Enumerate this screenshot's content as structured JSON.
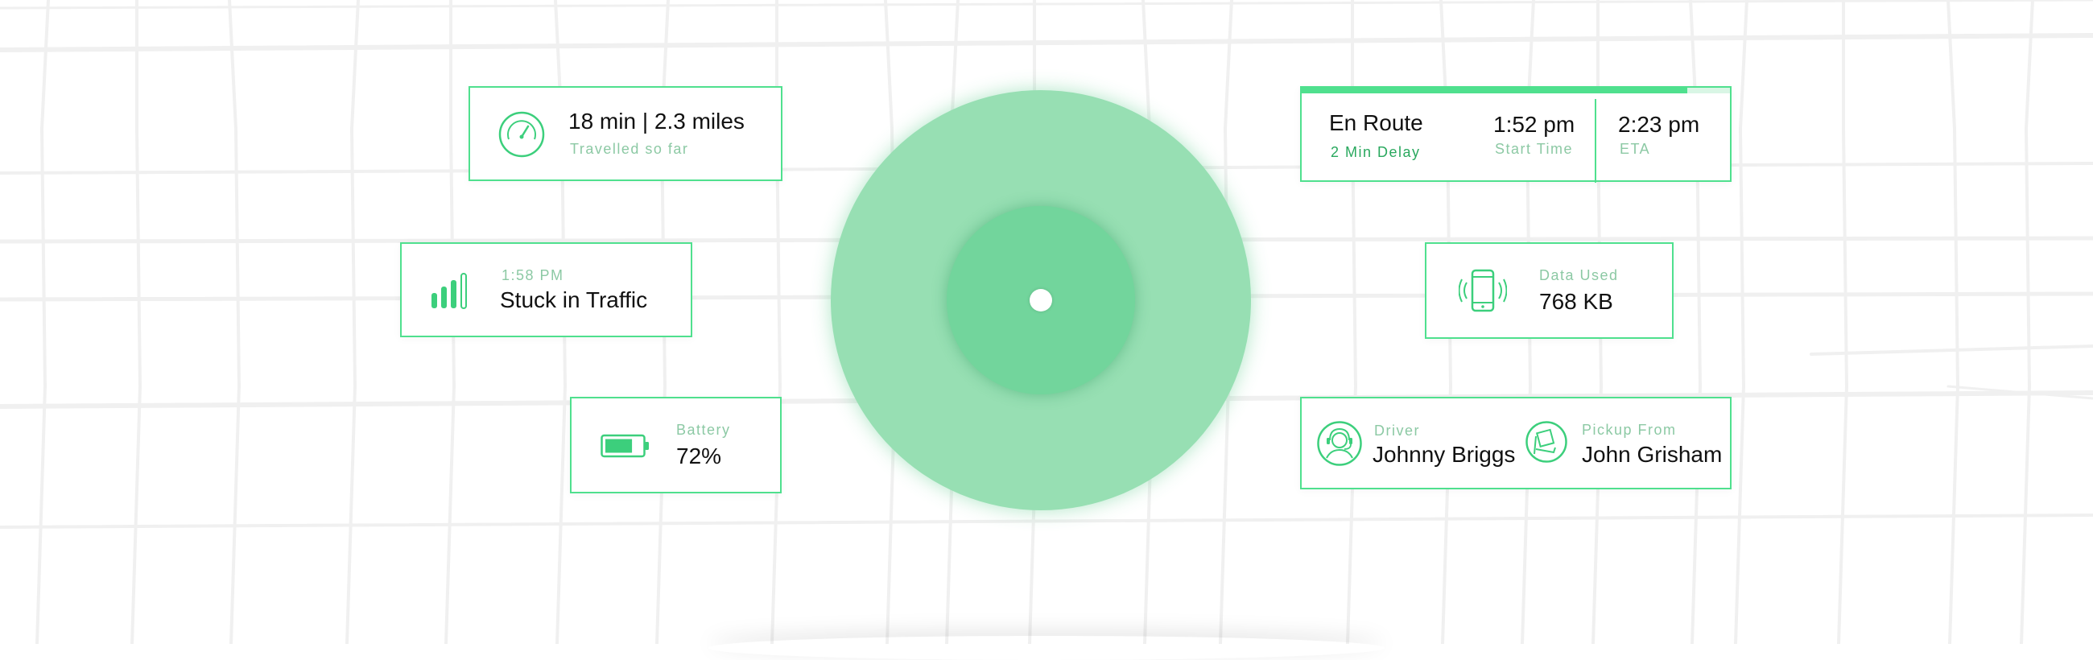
{
  "colors": {
    "accent": "#4fe08e",
    "accent_dark": "#29a85e",
    "radar_outer": "#97dfb3",
    "radar_inner": "#72d59c",
    "label": "#8cc9a4",
    "map_street": "#f0f0f0"
  },
  "map": {
    "street_color": "#f0f0f0"
  },
  "radar": {
    "center_icon": "location-dot-icon"
  },
  "travel_card": {
    "icon": "speedometer-icon",
    "value": "18 min | 2.3 miles",
    "label": "Travelled so far"
  },
  "traffic_card": {
    "icon": "signal-bars-icon",
    "time": "1:58 PM",
    "status": "Stuck in Traffic"
  },
  "battery_card": {
    "icon": "battery-icon",
    "label": "Battery",
    "value": "72%",
    "level": 0.72
  },
  "route_card": {
    "progress": 0.9,
    "status": "En Route",
    "delay": "2 Min Delay",
    "start_time": "1:52 pm",
    "start_label": "Start Time",
    "eta": "2:23 pm",
    "eta_label": "ETA"
  },
  "data_card": {
    "icon": "vibrating-phone-icon",
    "label": "Data Used",
    "value": "768 KB"
  },
  "people_card": {
    "driver_icon": "driver-avatar-icon",
    "driver_label": "Driver",
    "driver_name": "Johnny Briggs",
    "pickup_icon": "package-icon",
    "pickup_label": "Pickup From",
    "pickup_name": "John Grisham"
  }
}
